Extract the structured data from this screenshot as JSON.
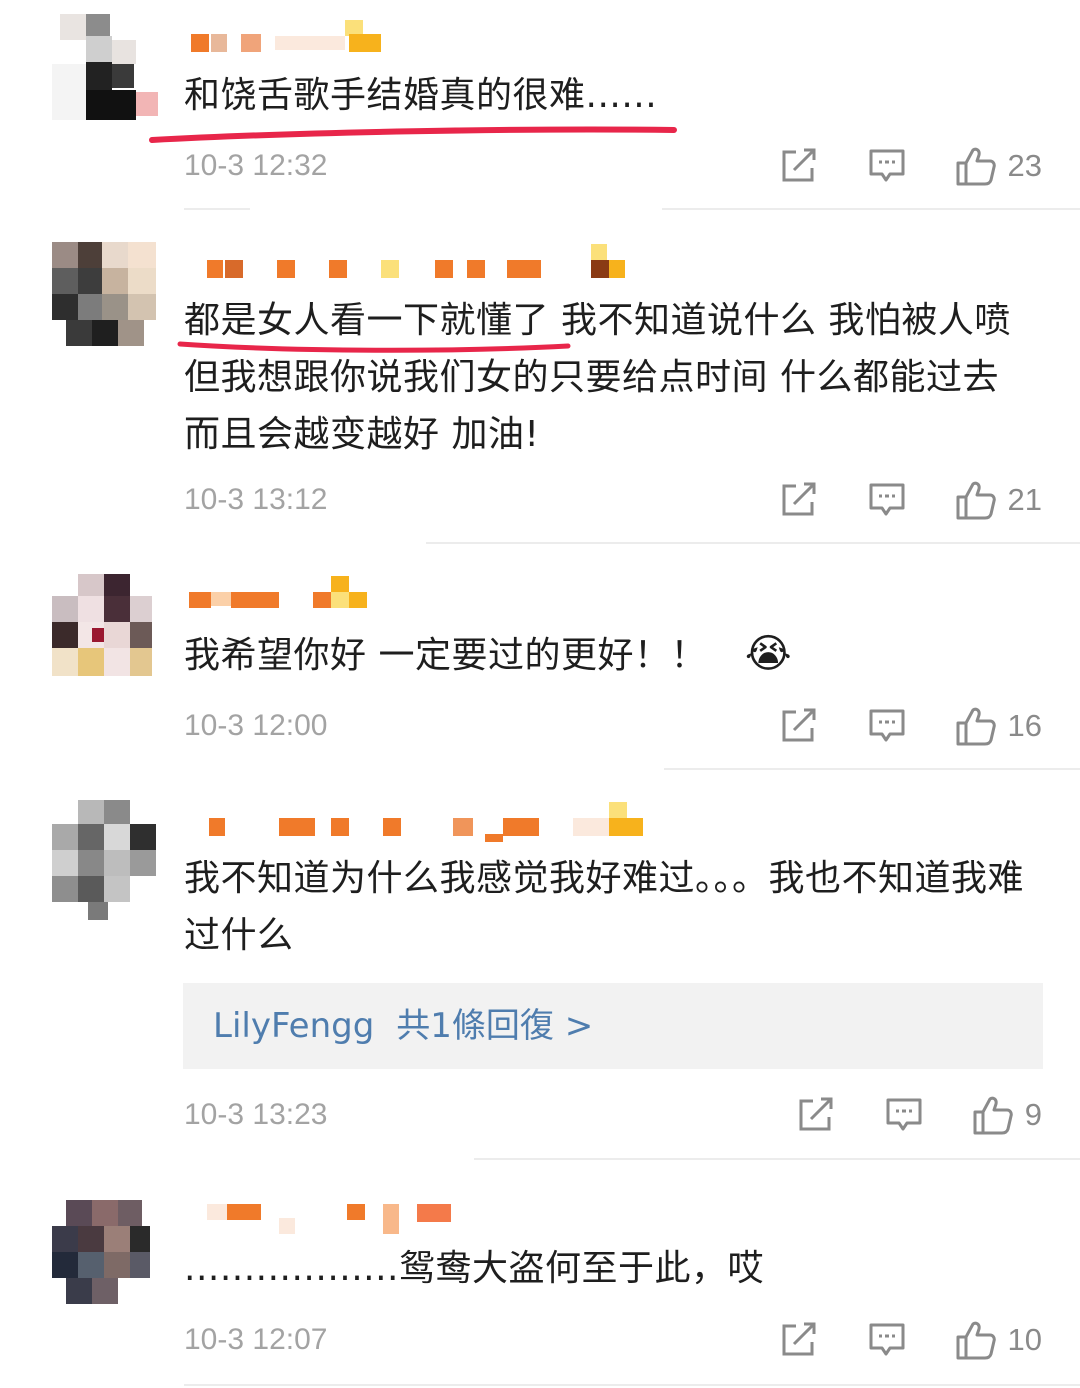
{
  "comments": [
    {
      "text": "和饶舌歌手结婚真的很难......",
      "time": "10-3 12:32",
      "likes": "23"
    },
    {
      "text": "都是女人看一下就懂了 我不知道说什么 我怕被人喷 但我想跟你说我们女的只要给点时间 什么都能过去 而且会越变越好 加油!",
      "time": "10-3 13:12",
      "likes": "21"
    },
    {
      "text": "我希望你好 一定要过的更好！！",
      "emoji": "😭",
      "time": "10-3 12:00",
      "likes": "16"
    },
    {
      "text": "我不知道为什么我感觉我好难过。。。我也不知道我难过什么",
      "time": "10-3 13:23",
      "likes": "9",
      "reply": {
        "name": "LilyFengg",
        "summary": "共1條回復 >"
      }
    },
    {
      "text": "..................鸳鸯大盗何至于此，哎",
      "time": "10-3 12:07",
      "likes": "10"
    }
  ],
  "colors": {
    "annotation_underline": "#e8264a",
    "reply_link": "#4f7dae",
    "timestamp": "#a3a3a3",
    "icon": "#8a8a8a"
  },
  "icons": [
    "share-icon",
    "comment-icon",
    "like-icon"
  ]
}
